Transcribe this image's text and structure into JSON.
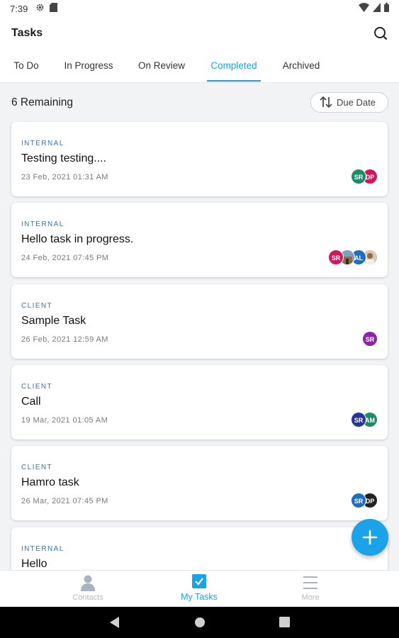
{
  "status_bar": {
    "time": "7:39"
  },
  "app_bar": {
    "title": "Tasks"
  },
  "tabs": [
    {
      "label": "To Do",
      "active": false
    },
    {
      "label": "In Progress",
      "active": false
    },
    {
      "label": "On Review",
      "active": false
    },
    {
      "label": "Completed",
      "active": true
    },
    {
      "label": "Archived",
      "active": false
    }
  ],
  "summary": {
    "remaining": "6 Remaining",
    "sort_label": "Due Date"
  },
  "tasks": [
    {
      "tag": "INTERNAL",
      "title": "Testing testing....",
      "date": "23 Feb, 2021 01:31 AM",
      "avatars": [
        {
          "initials": "SR",
          "color": "#1f8a6a"
        },
        {
          "initials": "DP",
          "color": "#d0185a"
        }
      ]
    },
    {
      "tag": "INTERNAL",
      "title": "Hello task in progress.",
      "date": "24 Feb, 2021 07:45 PM",
      "avatars": [
        {
          "initials": "SR",
          "color": "#d0185a"
        },
        {
          "initials": "",
          "color": "#8a6b4e"
        },
        {
          "initials": "AL",
          "color": "#1f6fbf"
        },
        {
          "initials": "",
          "color": "#c9b79c"
        }
      ]
    },
    {
      "tag": "CLIENT",
      "title": "Sample Task",
      "date": "26 Feb, 2021 12:59 AM",
      "avatars": [
        {
          "initials": "SR",
          "color": "#8e24aa"
        }
      ]
    },
    {
      "tag": "CLIENT",
      "title": "Call",
      "date": "19 Mar, 2021 01:05 AM",
      "avatars": [
        {
          "initials": "SR",
          "color": "#283593"
        },
        {
          "initials": "AM",
          "color": "#1f8a6a"
        }
      ]
    },
    {
      "tag": "CLIENT",
      "title": "Hamro task",
      "date": "26 Mar, 2021 07:45 PM",
      "avatars": [
        {
          "initials": "SR",
          "color": "#1f6fbf"
        },
        {
          "initials": "DP",
          "color": "#222222"
        }
      ]
    },
    {
      "tag": "INTERNAL",
      "title": "Hello",
      "date": "",
      "avatars": []
    }
  ],
  "bottom_nav": [
    {
      "label": "Contacts",
      "active": false,
      "icon": "person-icon"
    },
    {
      "label": "My Tasks",
      "active": true,
      "icon": "checkbox-icon"
    },
    {
      "label": "More",
      "active": false,
      "icon": "menu-icon"
    }
  ],
  "colors": {
    "accent": "#1aa3e8",
    "tag": "#3474a8"
  }
}
